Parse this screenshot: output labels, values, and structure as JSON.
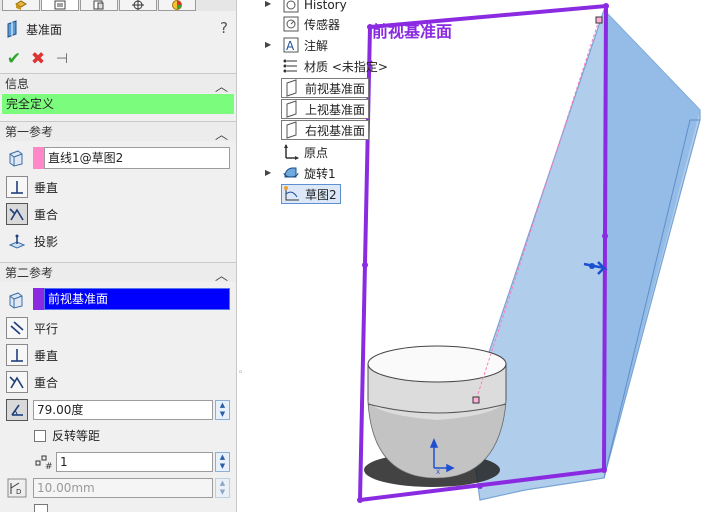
{
  "property_manager": {
    "title": "基准面",
    "help_label": "?",
    "tabs": [
      {
        "icon": "feature-manager-tab-icon"
      },
      {
        "icon": "property-manager-tab-icon"
      },
      {
        "icon": "configuration-manager-tab-icon"
      },
      {
        "icon": "dimxpert-tab-icon"
      },
      {
        "icon": "display-manager-tab-icon"
      }
    ],
    "actions": {
      "ok": "✔",
      "cancel": "✖",
      "pin": "⊣"
    },
    "info_section": {
      "header": "信息",
      "status": "完全定义",
      "status_color": "#7cfc7c"
    },
    "first_reference": {
      "header": "第一参考",
      "selection": "直线1@草图2",
      "selection_color": "#ff88c8",
      "options": [
        {
          "label": "垂直",
          "pressed": false
        },
        {
          "label": "重合",
          "pressed": true
        },
        {
          "label": "投影",
          "pressed": false
        }
      ]
    },
    "second_reference": {
      "header": "第二参考",
      "selection": "前视基准面",
      "selection_color": "#8a2be2",
      "selection_bg": "#0000ff",
      "options": [
        {
          "label": "平行",
          "pressed": false
        },
        {
          "label": "垂直",
          "pressed": false
        },
        {
          "label": "重合",
          "pressed": false
        }
      ],
      "angle_value": "79.00度",
      "flip_label": "反转等距",
      "flip_checked": false,
      "instances_value": "1",
      "distance_value": "10.00mm"
    }
  },
  "feature_tree": {
    "items": [
      {
        "label": "History",
        "icon": "history-icon",
        "expandable": true
      },
      {
        "label": "传感器",
        "icon": "sensor-icon",
        "expandable": false
      },
      {
        "label": "注解",
        "icon": "annotation-icon",
        "expandable": true
      },
      {
        "label": "材质 <未指定>",
        "icon": "material-icon",
        "expandable": false
      },
      {
        "label": "前视基准面",
        "icon": "plane-icon",
        "expandable": false
      },
      {
        "label": "上视基准面",
        "icon": "plane-icon",
        "expandable": false
      },
      {
        "label": "右视基准面",
        "icon": "plane-icon",
        "expandable": false
      },
      {
        "label": "原点",
        "icon": "origin-icon",
        "expandable": false
      },
      {
        "label": "旋转1",
        "icon": "revolve-icon",
        "expandable": true
      },
      {
        "label": "草图2",
        "icon": "sketch-icon",
        "expandable": false
      }
    ]
  },
  "viewport": {
    "plane_label": "前视基准面",
    "plane_color": "#8a2be2",
    "new_plane_color": "#8fb8e6"
  }
}
